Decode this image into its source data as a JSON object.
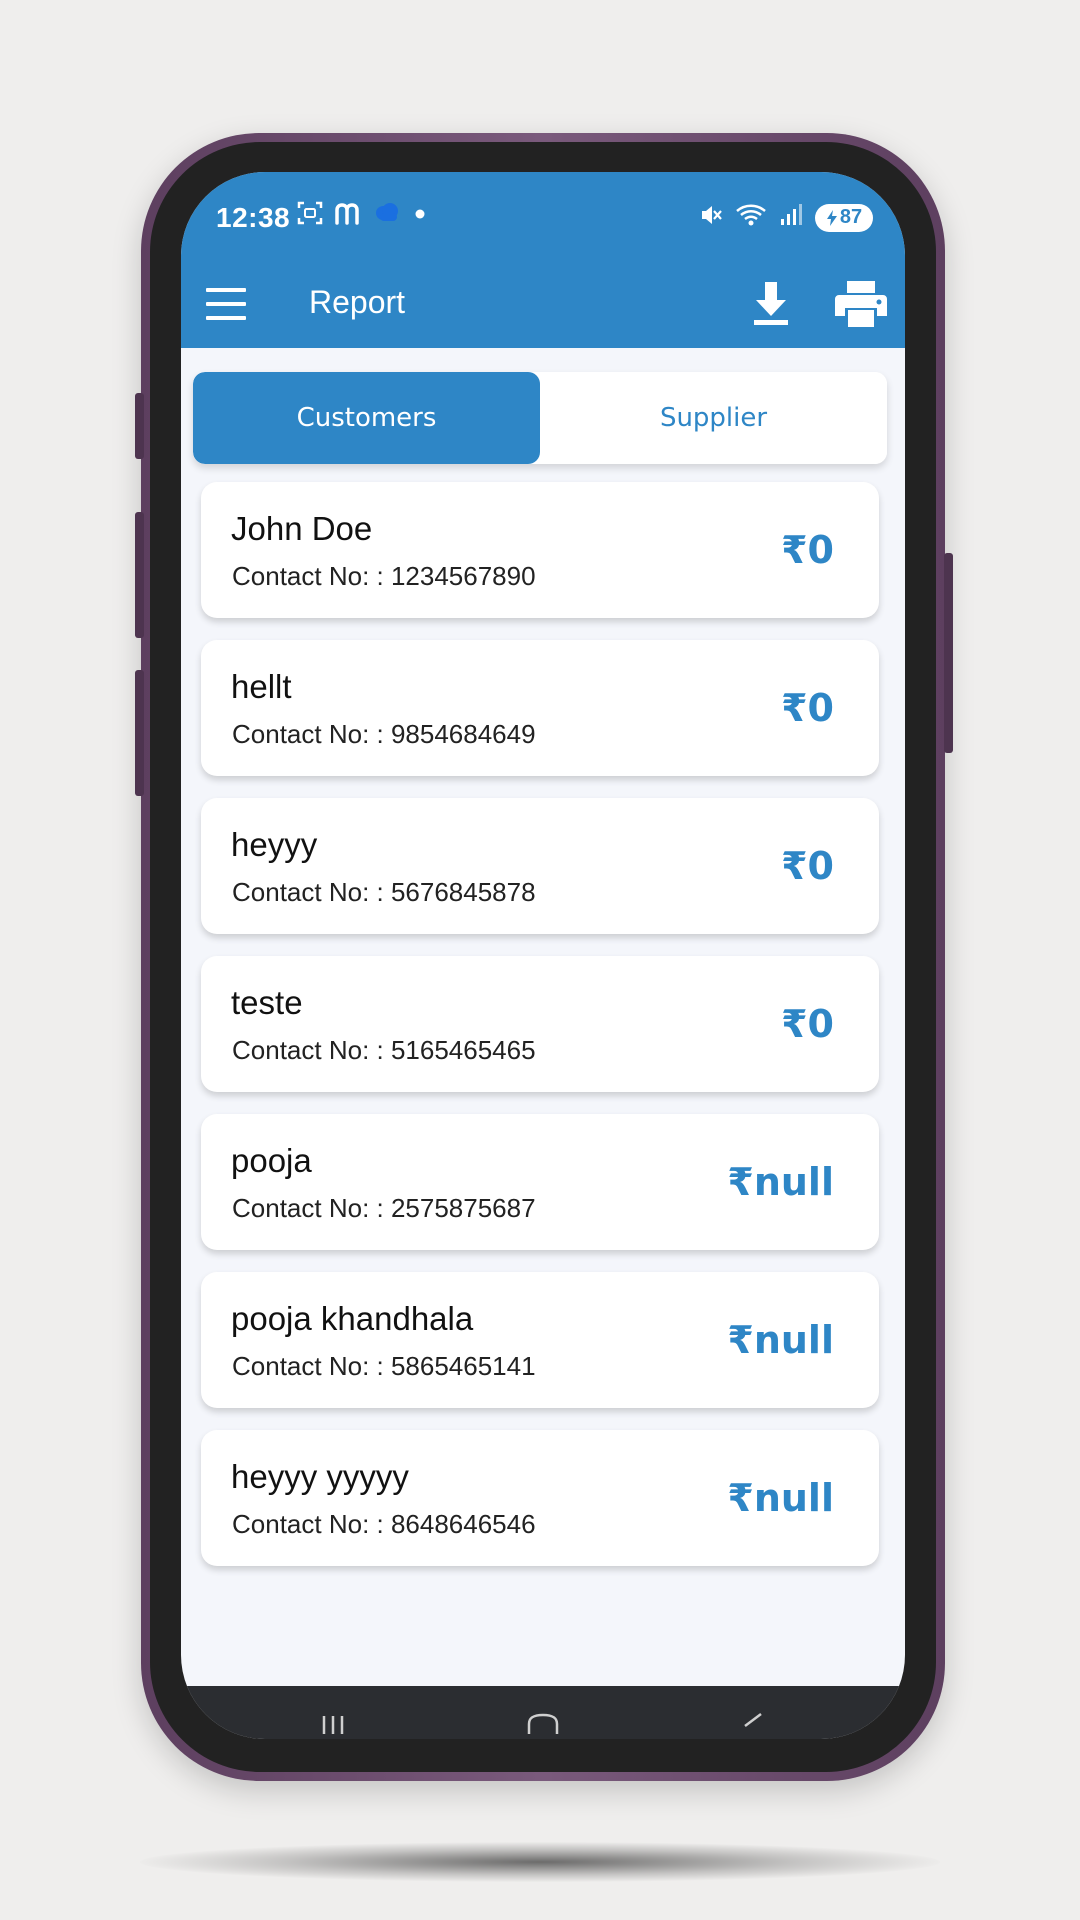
{
  "status_bar": {
    "time": "12:38",
    "battery": "87",
    "icons_left": [
      "screenshot-icon",
      "m-app-icon",
      "cloud-icon",
      "dot-icon"
    ],
    "icons_right": [
      "mute-icon",
      "wifi-icon",
      "signal-icon",
      "battery-icon"
    ]
  },
  "app_bar": {
    "title": "Report",
    "actions": [
      "download-icon",
      "print-icon"
    ]
  },
  "tabs": [
    {
      "label": "Customers",
      "active": true
    },
    {
      "label": "Supplier",
      "active": false
    }
  ],
  "contacts": [
    {
      "name": "John Doe",
      "contact": "Contact No: : 1234567890",
      "amount": "₹0"
    },
    {
      "name": "hellt",
      "contact": "Contact No: : 9854684649",
      "amount": "₹0"
    },
    {
      "name": "heyyy",
      "contact": "Contact No: : 5676845878",
      "amount": "₹0"
    },
    {
      "name": "teste",
      "contact": "Contact No: : 5165465465",
      "amount": "₹0"
    },
    {
      "name": "pooja",
      "contact": "Contact No: : 2575875687",
      "amount": "₹null"
    },
    {
      "name": "pooja khandhala",
      "contact": "Contact No: : 5865465141",
      "amount": "₹null"
    },
    {
      "name": "heyyy yyyyy",
      "contact": "Contact No: : 8648646546",
      "amount": "₹null"
    }
  ],
  "nav_bar": {
    "items": [
      "recent-apps-icon",
      "home-icon",
      "back-icon"
    ]
  },
  "colors": {
    "primary": "#2e86c6",
    "background": "#f4f6fb",
    "card": "#ffffff",
    "frame": "#6a4d6c"
  }
}
